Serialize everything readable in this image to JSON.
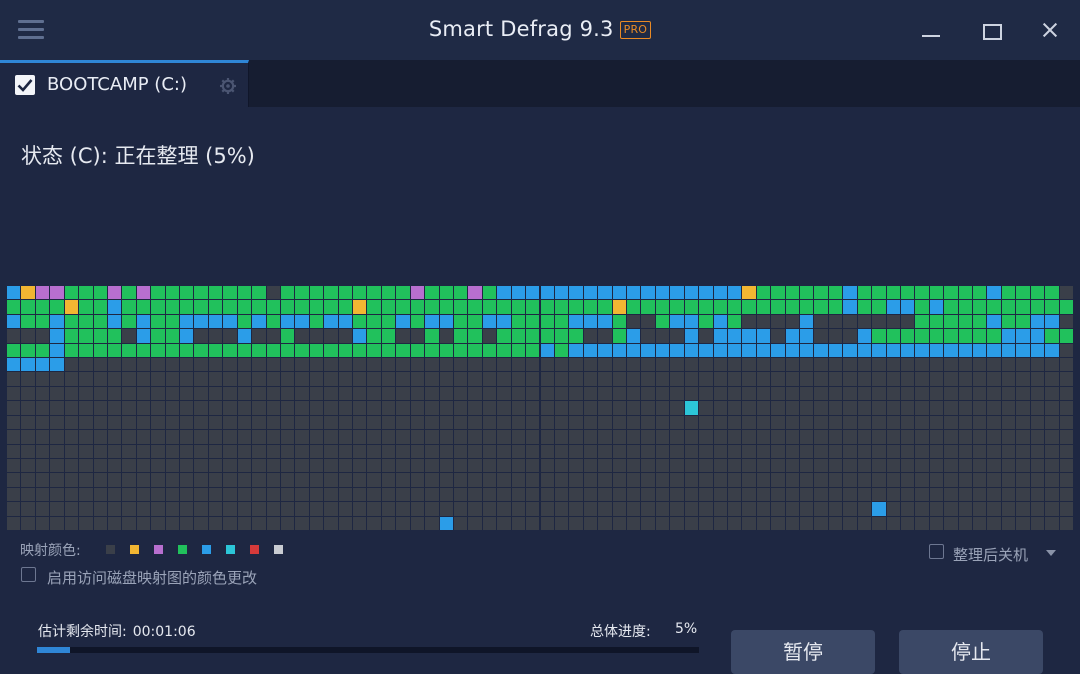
{
  "app": {
    "title": "Smart Defrag 9.3",
    "badge": "PRO"
  },
  "tab": {
    "label": "BOOTCAMP (C:)",
    "checked": true
  },
  "status": {
    "text": "状态 (C): 正在整理 (5%)"
  },
  "legend": {
    "label": "映射颜色:",
    "colors": [
      "#3a3f49",
      "#f2b632",
      "#b86fcf",
      "#21c15c",
      "#2b9de8",
      "#2cc6d8",
      "#d63a3a",
      "#c9ccd2"
    ]
  },
  "options": {
    "color_change_label": "启用访问磁盘映射图的颜色更改",
    "shutdown_label": "整理后关机"
  },
  "progress": {
    "eta_label": "估计剩余时间:",
    "eta_value": "00:01:06",
    "total_label": "总体进度:",
    "total_value": "5%",
    "fraction": 0.05
  },
  "buttons": {
    "pause": "暂停",
    "stop": "停止"
  },
  "disk_map": {
    "columns": 74,
    "rows": 17,
    "colors": {
      "E": "#3a3f49",
      "G": "#21c15c",
      "B": "#2b9de8",
      "Y": "#f2b632",
      "P": "#b86fcf",
      "C": "#2cc6d8"
    },
    "rows_data": [
      "BYPPGGGPGPGGGGGGGGEGGGGGGGGGPGGGPGBBBBBBBBBBBBBBBBBYGGGGGGBGGGGGGGGGBGGGG",
      "GGGGYGGBGGGGGGGGGGGGGGGGYGGGGGGGGGGGGGGGGGYGGGGGGGGGGGGGGGBGGBBGBGGGGGGGGGGG",
      "BGGBGGGBGBGGBBBBGBGBBGBBGGGBGBBGGBBGGGGBBBGEEGBBGBGEEEEBEEEEEEEGGGGGBGGBB",
      "EEEBGGGGEBGGBEEEBEEGEEEEBGGEEGEGGEGGGGGGEEGBEEEBEBBBBEBBEEEBGGGGGGGGGBBBGG",
      "GGGBGGGGGGGGGGGGGGGGGGGGGGGGGGGGGGGGGBGBBBBBBBBBBBBBBBBBBBBBBBBBBBBBBBBBB",
      "BBBBEEEEEEEEEEEEEEEEEEEEEEEEEEEEEEEEEEEEEEEEEEEEEEEEEEEEEEEEEEEEEEEEEEEEEE"
    ],
    "special_cells": [
      {
        "row": 8,
        "col": 47,
        "color": "C"
      },
      {
        "row": 15,
        "col": 60,
        "color": "B"
      },
      {
        "row": 16,
        "col": 30,
        "color": "B"
      }
    ]
  }
}
